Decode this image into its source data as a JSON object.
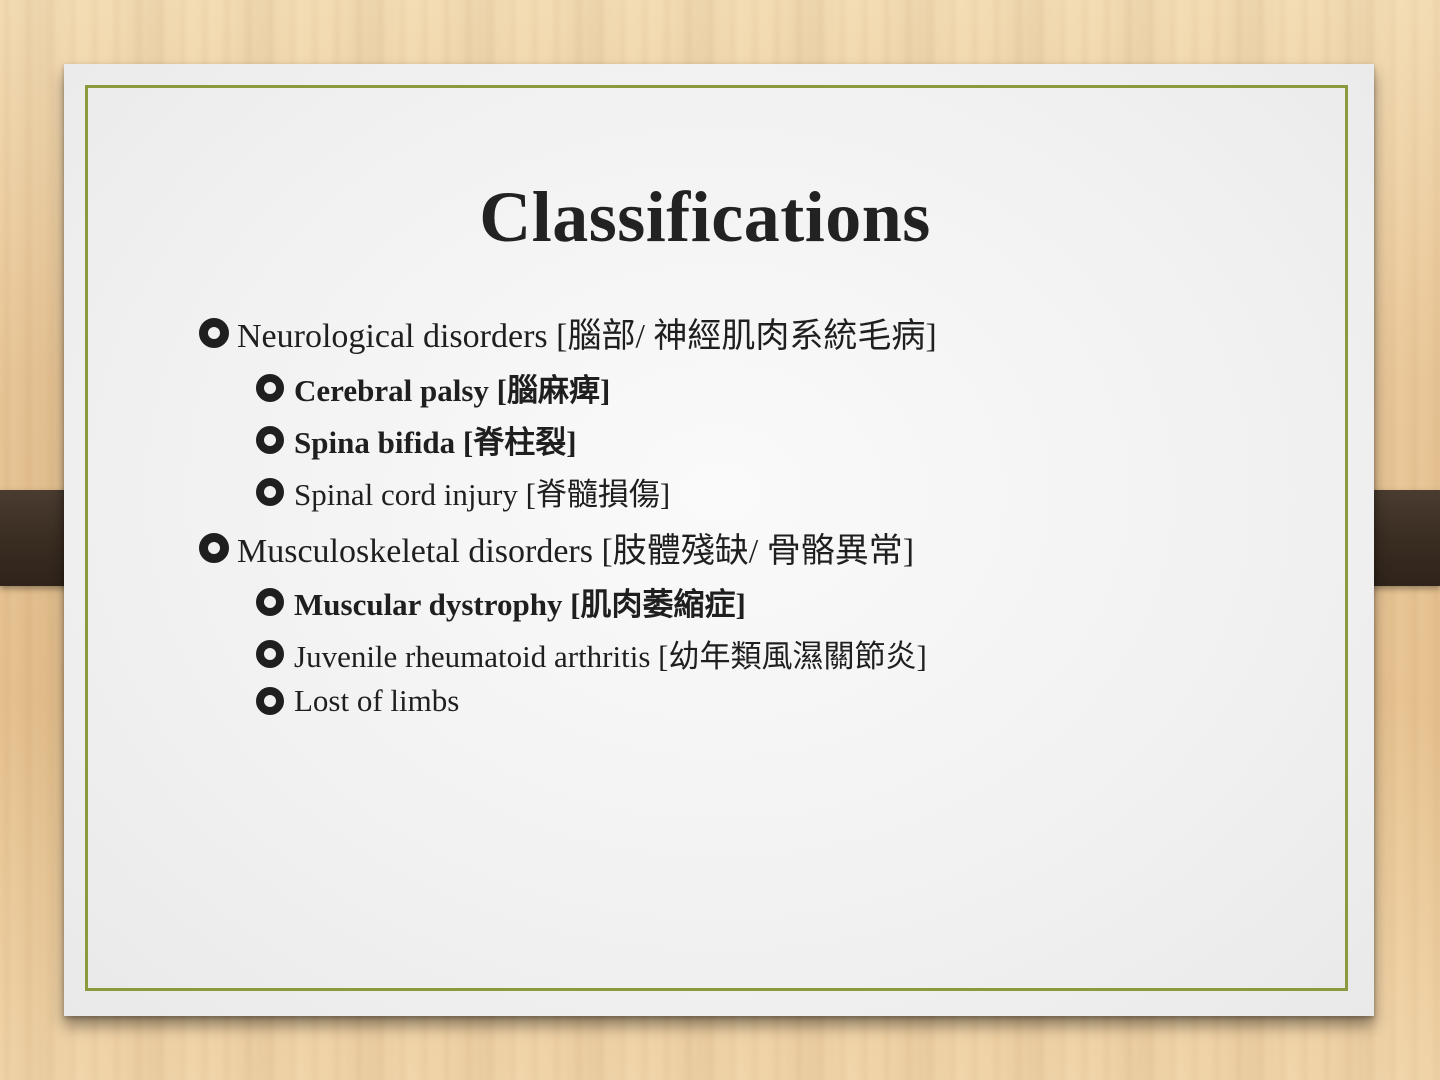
{
  "slide": {
    "title": "Classifications",
    "bullets": [
      {
        "level": 1,
        "bold": false,
        "text": "Neurological disorders [腦部/ 神經肌肉系統毛病]"
      },
      {
        "level": 2,
        "bold": true,
        "text": "Cerebral palsy [腦麻痺]"
      },
      {
        "level": 2,
        "bold": true,
        "text": "Spina bifida [脊柱裂]"
      },
      {
        "level": 2,
        "bold": false,
        "text": "Spinal cord injury [脊髓損傷]"
      },
      {
        "level": 1,
        "bold": false,
        "text": "Musculoskeletal disorders [肢體殘缺/ 骨骼異常]"
      },
      {
        "level": 2,
        "bold": true,
        "text": "Muscular dystrophy [肌肉萎縮症]"
      },
      {
        "level": 2,
        "bold": false,
        "text": "Juvenile rheumatoid arthritis [幼年類風濕關節炎]"
      },
      {
        "level": 2,
        "bold": false,
        "text": "Lost of limbs"
      }
    ]
  },
  "colors": {
    "frame_accent": "#8a9a3c",
    "text": "#1f1f1f",
    "clip": "#3a2d22"
  },
  "icons": {
    "bullet": "ring-bullet-icon"
  }
}
